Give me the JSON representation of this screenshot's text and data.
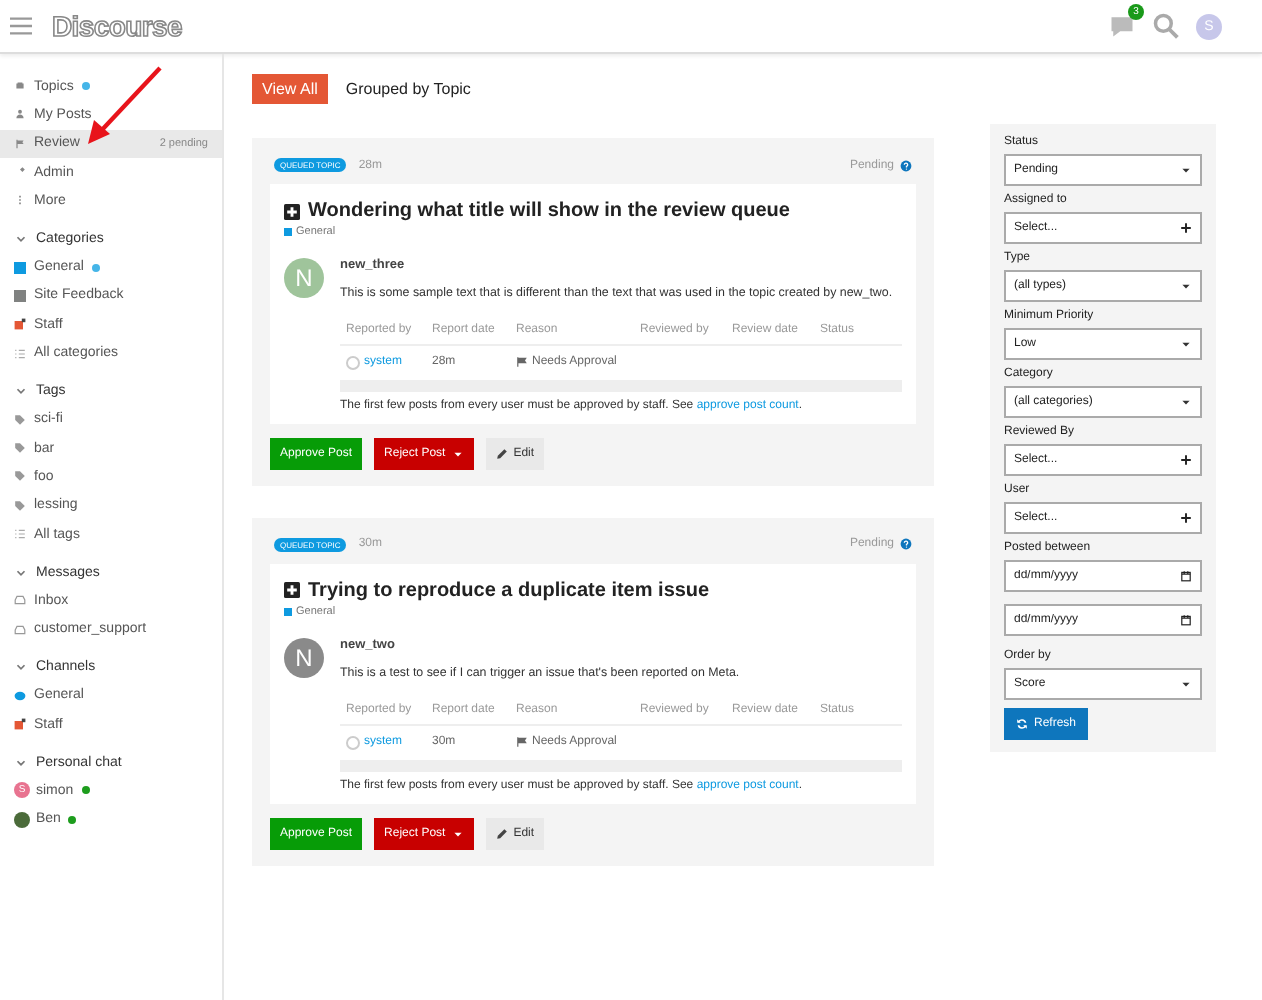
{
  "header": {
    "logo": "Discourse",
    "chat_badge": "3",
    "avatar_letter": "S"
  },
  "sidebar": {
    "sections": [
      {
        "items": [
          {
            "label": "Topics",
            "kind": "link",
            "unread": true,
            "selected": false
          },
          {
            "label": "My Posts",
            "kind": "link",
            "unread": false,
            "selected": false
          },
          {
            "label": "Review",
            "kind": "link",
            "unread": false,
            "selected": true,
            "count": "2 pending"
          },
          {
            "label": "Admin",
            "kind": "link",
            "unread": false,
            "selected": false
          },
          {
            "label": "More",
            "kind": "link",
            "unread": false,
            "selected": false
          }
        ]
      },
      {
        "title": "Categories",
        "expanded": true,
        "items": [
          {
            "label": "General",
            "kind": "category",
            "color": "#0e9ae0",
            "unread": true,
            "selected": false
          },
          {
            "label": "Site Feedback",
            "kind": "category",
            "color": "#808281",
            "unread": false,
            "selected": false
          },
          {
            "label": "Staff",
            "kind": "locked",
            "color": "#e45735",
            "unread": false,
            "selected": false
          },
          {
            "label": "All categories",
            "kind": "all",
            "unread": false,
            "selected": false
          }
        ]
      },
      {
        "title": "Tags",
        "expanded": true,
        "items": [
          {
            "label": "sci-fi",
            "kind": "tag",
            "unread": false,
            "selected": false
          },
          {
            "label": "bar",
            "kind": "tag",
            "unread": false,
            "selected": false
          },
          {
            "label": "foo",
            "kind": "tag",
            "unread": false,
            "selected": false
          },
          {
            "label": "lessing",
            "kind": "tag",
            "unread": false,
            "selected": false
          },
          {
            "label": "All tags",
            "kind": "all",
            "unread": false,
            "selected": false
          }
        ]
      },
      {
        "title": "Messages",
        "expanded": true,
        "items": [
          {
            "label": "Inbox",
            "kind": "inbox",
            "unread": false,
            "selected": false
          },
          {
            "label": "customer_support",
            "kind": "inbox",
            "unread": false,
            "selected": false
          }
        ]
      },
      {
        "title": "Channels",
        "expanded": true,
        "items": [
          {
            "label": "General",
            "kind": "channel",
            "color": "#0e9ae0",
            "unread": false,
            "selected": false
          },
          {
            "label": "Staff",
            "kind": "locked",
            "color": "#e45735",
            "unread": false,
            "selected": false
          }
        ]
      },
      {
        "title": "Personal chat",
        "expanded": true,
        "items": [
          {
            "label": "simon",
            "kind": "user",
            "letter": "S",
            "color": "#e87390",
            "online": true,
            "unread": false,
            "selected": false
          },
          {
            "label": "Ben",
            "kind": "user",
            "color": "#4b6b3a",
            "online": true,
            "unread": false,
            "selected": false
          }
        ]
      }
    ]
  },
  "tabs": [
    {
      "label": "View All",
      "selected": true
    },
    {
      "label": "Grouped by Topic",
      "selected": false
    }
  ],
  "reviewables": [
    {
      "badge": "QUEUED TOPIC",
      "age": "28m",
      "status": "Pending",
      "title": "Wondering what title will show in the review queue",
      "category": {
        "name": "General",
        "color": "#0e9ae0"
      },
      "user": "new_three",
      "avatar": {
        "letter": "N",
        "color": "#9fc49b"
      },
      "body": "This is some sample text that is different than the text that was used in the topic created by new_two.",
      "columns": [
        "Reported by",
        "Report date",
        "Reason",
        "Reviewed by",
        "Review date",
        "Status"
      ],
      "row": {
        "reported_by": "system",
        "report_date": "28m",
        "reason": "Needs Approval"
      },
      "note": "The first few posts from every user must be approved by staff. See ",
      "note_link": "approve post count",
      "note_end": ".",
      "buttons": [
        {
          "label": "Approve Post",
          "kind": "approve"
        },
        {
          "label": "Reject Post",
          "kind": "reject"
        },
        {
          "label": "Edit",
          "kind": "edit"
        }
      ]
    },
    {
      "badge": "QUEUED TOPIC",
      "age": "30m",
      "status": "Pending",
      "title": "Trying to reproduce a duplicate item issue",
      "category": {
        "name": "General",
        "color": "#0e9ae0"
      },
      "user": "new_two",
      "avatar": {
        "letter": "N",
        "color": "#8a8a8a"
      },
      "body": "This is a test to see if I can trigger an issue that's been reported on Meta.",
      "columns": [
        "Reported by",
        "Report date",
        "Reason",
        "Reviewed by",
        "Review date",
        "Status"
      ],
      "row": {
        "reported_by": "system",
        "report_date": "30m",
        "reason": "Needs Approval"
      },
      "note": "The first few posts from every user must be approved by staff. See ",
      "note_link": "approve post count",
      "note_end": ".",
      "buttons": [
        {
          "label": "Approve Post",
          "kind": "approve"
        },
        {
          "label": "Reject Post",
          "kind": "reject"
        },
        {
          "label": "Edit",
          "kind": "edit"
        }
      ]
    }
  ],
  "filters": [
    {
      "label": "Status",
      "kind": "select",
      "value": "Pending"
    },
    {
      "label": "Assigned to",
      "kind": "chooser",
      "placeholder": "Select..."
    },
    {
      "label": "Type",
      "kind": "select",
      "value": "(all types)"
    },
    {
      "label": "Minimum Priority",
      "kind": "select",
      "value": "Low"
    },
    {
      "label": "Category",
      "kind": "select",
      "value": "(all categories)"
    },
    {
      "label": "Reviewed By",
      "kind": "chooser",
      "placeholder": "Select..."
    },
    {
      "label": "User",
      "kind": "chooser",
      "placeholder": "Select..."
    },
    {
      "label": "Posted between",
      "kind": "dates",
      "placeholders": [
        "dd/mm/yyyy",
        "dd/mm/yyyy"
      ]
    },
    {
      "label": "Order by",
      "kind": "select",
      "value": "Score"
    }
  ],
  "refresh_button": "Refresh"
}
